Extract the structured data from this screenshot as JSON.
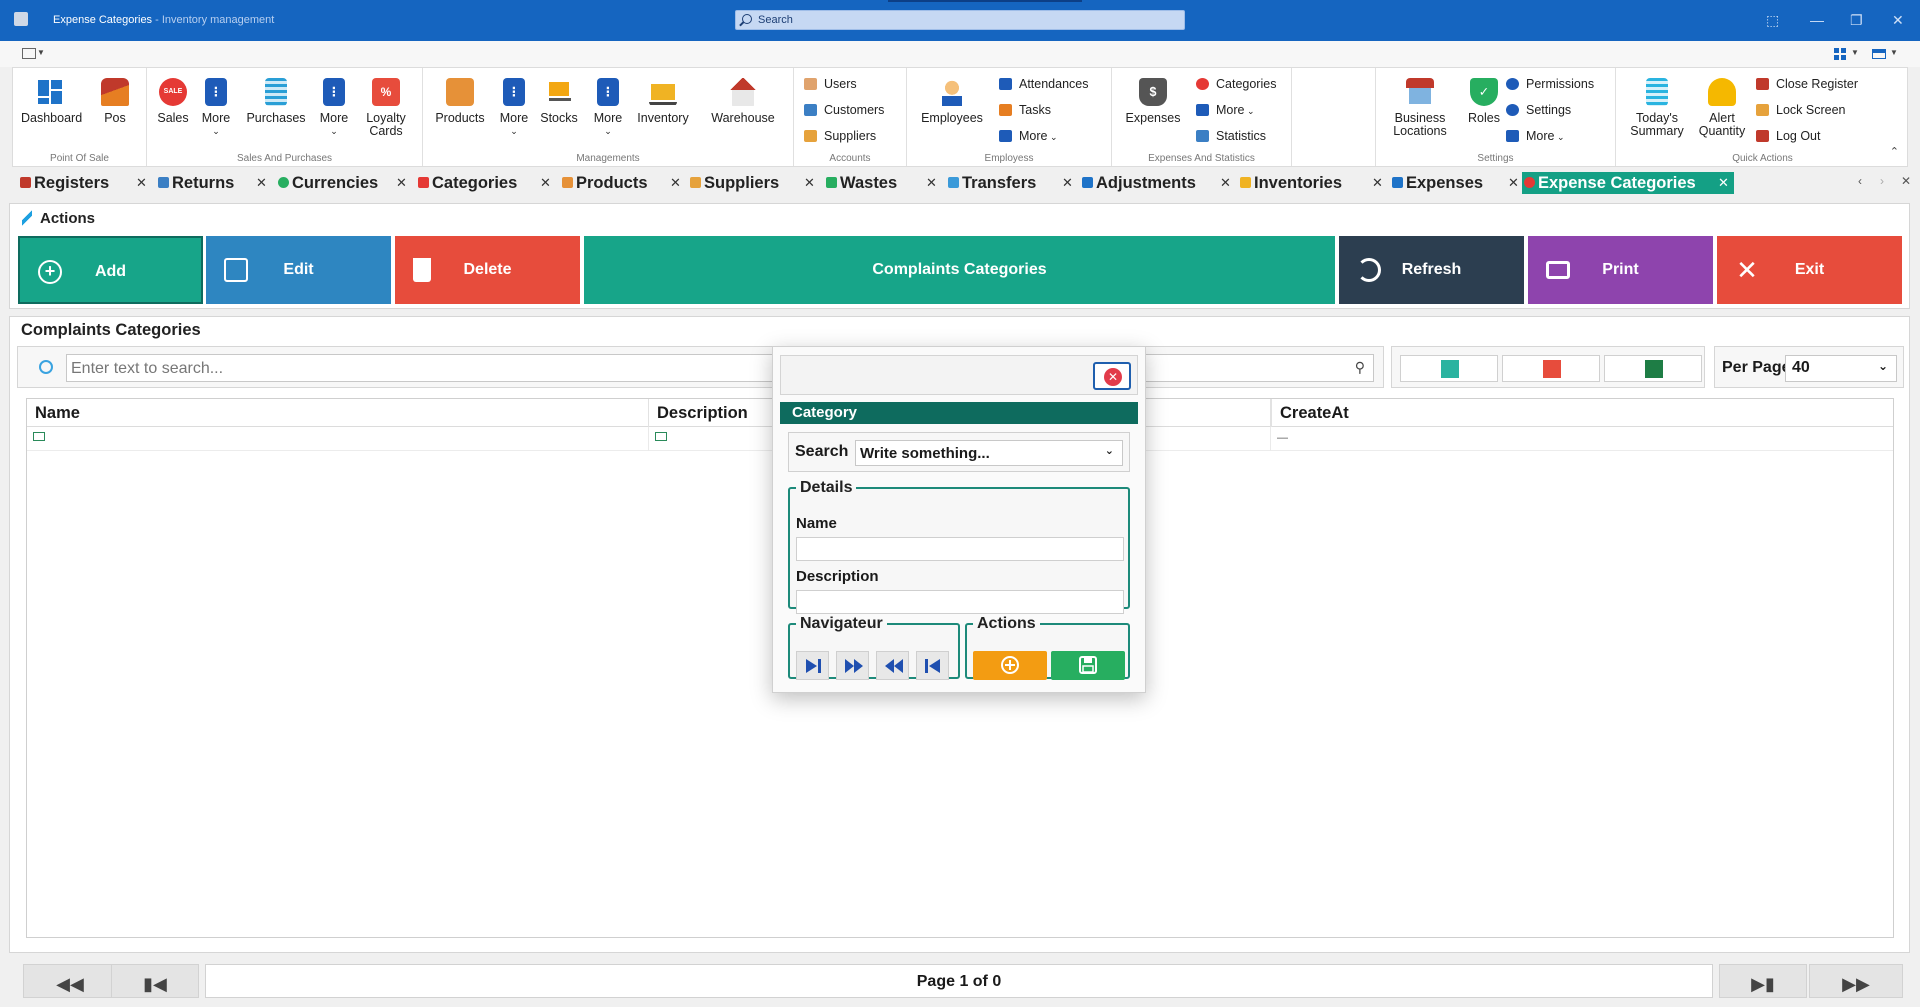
{
  "window": {
    "title": "Expense Categories",
    "subtitle": " - Inventory management",
    "search_placeholder": "Search",
    "controls": [
      "⬚",
      "—",
      "❐",
      "✕"
    ]
  },
  "ribbon": {
    "groups": {
      "point_of_sale": "Point Of Sale",
      "sales_purchases": "Sales And Purchases",
      "managements": "Managements",
      "accounts": "Accounts",
      "employees": "Employess",
      "expenses_stats": "Expenses And Statistics",
      "settings": "Settings",
      "quick_actions": "Quick Actions"
    },
    "dashboard": "Dashboard",
    "pos": "Pos",
    "sales": "Sales",
    "sales_badge": "SALE",
    "more1": "More",
    "purchases": "Purchases",
    "more2": "More",
    "loyalty_cards": "Loyalty Cards",
    "products": "Products",
    "more3": "More",
    "stocks": "Stocks",
    "more4": "More",
    "inventory": "Inventory",
    "warehouse": "Warehouse",
    "users": "Users",
    "customers": "Customers",
    "suppliers": "Suppliers",
    "employees_btn": "Employees",
    "attendances": "Attendances",
    "tasks": "Tasks",
    "more5": "More",
    "expenses": "Expenses",
    "categories": "Categories",
    "more6": "More",
    "statistics": "Statistics",
    "business_locations": "Business Locations",
    "roles": "Roles",
    "permissions": "Permissions",
    "settings_btn": "Settings",
    "more7": "More",
    "todays_summary": "Today's Summary",
    "alert_quantity": "Alert Quantity",
    "close_register": "Close Register",
    "lock_screen": "Lock Screen",
    "log_out": "Log Out"
  },
  "tabs": [
    {
      "label": "Registers"
    },
    {
      "label": "Returns"
    },
    {
      "label": "Currencies"
    },
    {
      "label": "Categories"
    },
    {
      "label": "Products"
    },
    {
      "label": "Suppliers"
    },
    {
      "label": "Wastes"
    },
    {
      "label": "Transfers"
    },
    {
      "label": "Adjustments"
    },
    {
      "label": "Inventories"
    },
    {
      "label": "Expenses"
    },
    {
      "label": "Expense Categories",
      "active": true
    }
  ],
  "actions": {
    "title": "Actions",
    "add": "Add",
    "edit": "Edit",
    "delete": "Delete",
    "complaints": "Complaints Categories",
    "refresh": "Refresh",
    "print": "Print",
    "exit": "Exit"
  },
  "grid": {
    "title": "Complaints Categories",
    "search_placeholder": "Enter text to search...",
    "per_page_label": "Per Page",
    "per_page_value": "40",
    "columns": [
      "Name",
      "Description",
      "",
      "CreateAt"
    ],
    "row_createat": "—"
  },
  "pager": {
    "info": "Page 1 of 0"
  },
  "dialog": {
    "header": "Category",
    "search_label": "Search",
    "search_value": "Write something...",
    "details_legend": "Details",
    "name_label": "Name",
    "name_value": "",
    "description_label": "Description",
    "description_value": "",
    "navigator_legend": "Navigateur",
    "actions_legend": "Actions"
  },
  "colors": {
    "titlebar": "#1565c0",
    "add": "#17a589",
    "edit": "#2e86c1",
    "delete": "#e74c3c",
    "complaints": "#17a589",
    "refresh": "#2c3e50",
    "print": "#8e44ad",
    "exit": "#e74c3c",
    "dialog_header": "#0e6b5e"
  }
}
